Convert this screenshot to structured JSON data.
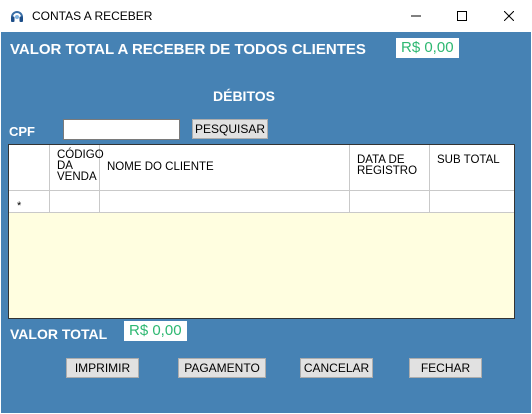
{
  "window": {
    "title": "CONTAS A RECEBER",
    "icon": "headset-icon",
    "controls": {
      "minimize": "minimize-icon",
      "maximize": "maximize-icon",
      "close": "close-icon"
    }
  },
  "header": {
    "total_all_label": "VALOR TOTAL A RECEBER DE TODOS CLIENTES",
    "total_all_value": "R$ 0,00"
  },
  "section_title": "DÉBITOS",
  "search": {
    "cpf_label": "CPF",
    "cpf_value": "",
    "button_label": "PESQUISAR"
  },
  "grid": {
    "columns": [
      "CÓDIGO DA VENDA",
      "NOME DO CLIENTE",
      "DATA DE REGISTRO",
      "SUB TOTAL"
    ],
    "new_row_marker": "*",
    "rows": []
  },
  "footer": {
    "total_label": "VALOR TOTAL",
    "total_value": "R$ 0,00",
    "buttons": {
      "imprimir": "IMPRIMIR",
      "pagamento": "PAGAMENTO",
      "cancelar": "CANCELAR",
      "fechar": "FECHAR"
    }
  },
  "colors": {
    "client_background": "#4682b4",
    "value_text": "#2eb872",
    "grid_background": "#fffee0"
  }
}
